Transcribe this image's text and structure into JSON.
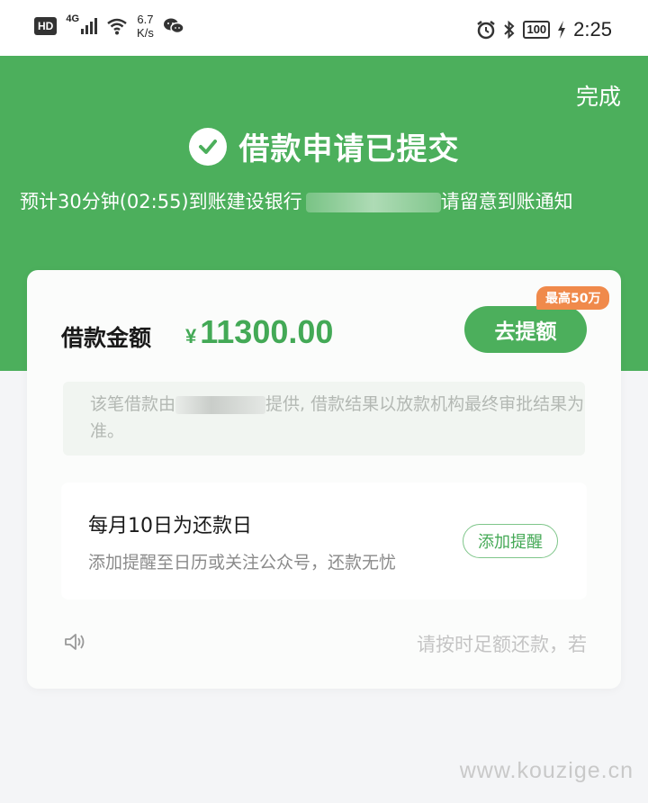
{
  "status_bar": {
    "hd": "HD",
    "network": "4G",
    "speed_value": "6.7",
    "speed_unit": "K/s",
    "battery": "100",
    "time": "2:25"
  },
  "header": {
    "done_label": "完成",
    "title": "借款申请已提交",
    "subtitle_prefix": "预计30分钟(02:55)到账建设银行",
    "subtitle_suffix": "请留意到账通知"
  },
  "card": {
    "amount_label": "借款金额",
    "currency": "¥",
    "amount": "11300.00",
    "raise_button": "去提额",
    "max_badge": "最高50万",
    "notice_prefix": "该笔借款由",
    "notice_suffix": "提供, 借款结果以放款机构最终审批结果为准。"
  },
  "repay": {
    "title": "每月10日为还款日",
    "desc": "添加提醒至日历或关注公众号，还款无忧",
    "remind_button": "添加提醒"
  },
  "marquee": "请按时足额还款，若",
  "watermark": "www.kouzige.cn",
  "colors": {
    "brand_green": "#4caf5c",
    "amount_green": "#43a956",
    "badge_orange": "#f08a4b"
  }
}
